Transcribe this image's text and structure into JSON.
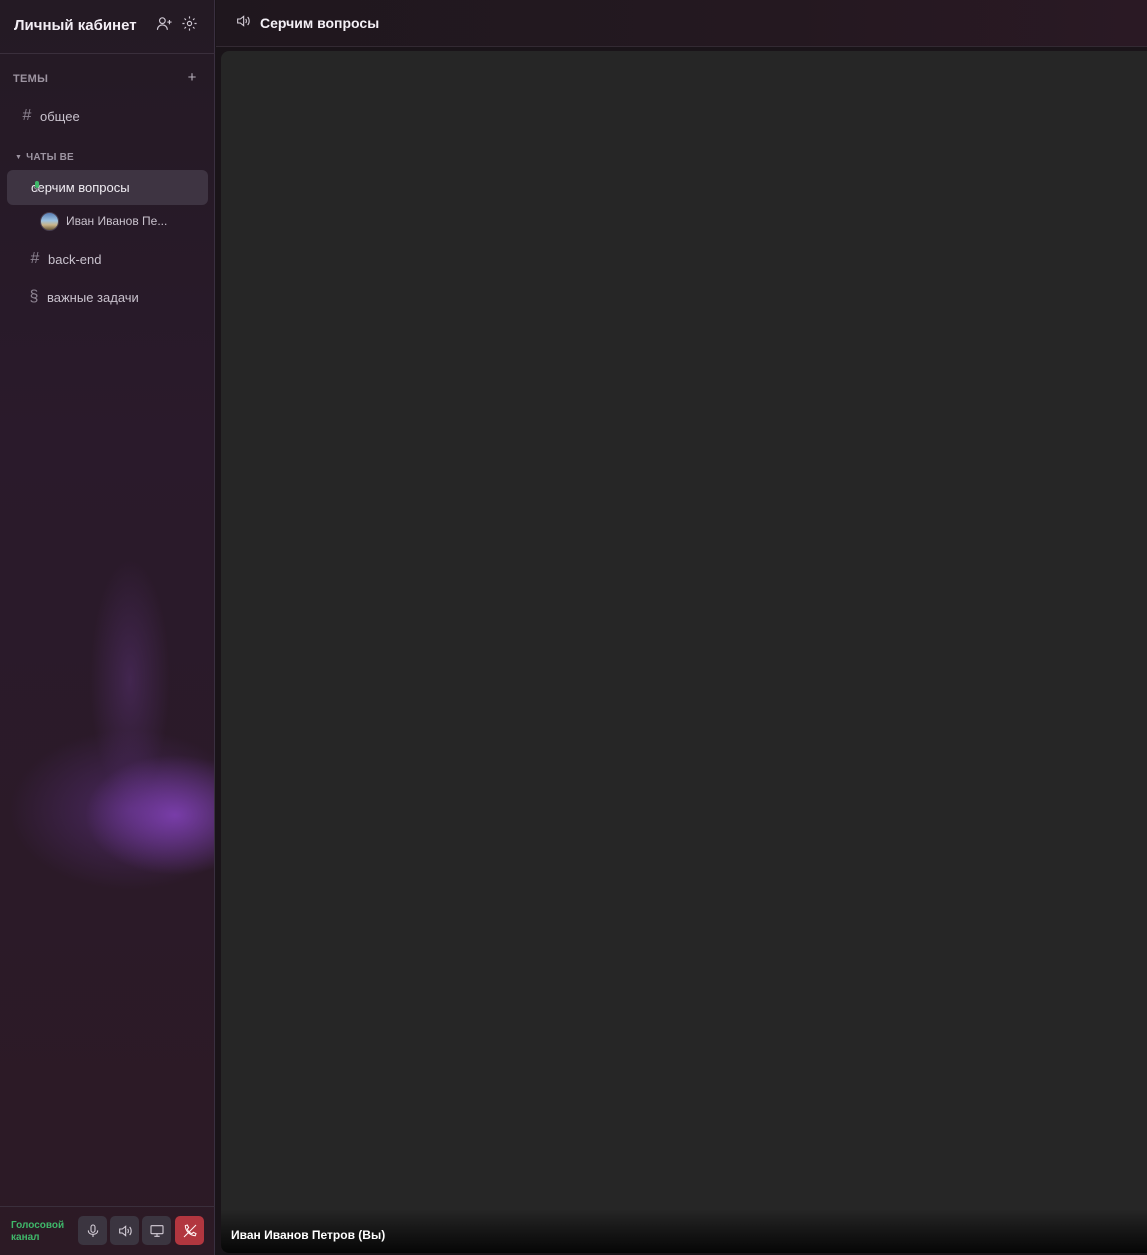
{
  "sidebar": {
    "title": "Личный кабинет",
    "section_label": "ТЕМЫ",
    "section_add": "+",
    "channels_top": [
      {
        "glyph": "#",
        "label": "общее"
      }
    ],
    "category": {
      "label": "ЧАТЫ ВЕ",
      "caret": "▼",
      "active_channel": {
        "label": "серчим вопросы",
        "icon": "mic-icon"
      },
      "members": [
        {
          "name": "Иван Иванов Пе..."
        }
      ]
    },
    "channels_bottom": [
      {
        "glyph": "#",
        "label": "back-end"
      },
      {
        "glyph": "§",
        "label": "важные задачи"
      }
    ]
  },
  "voice_panel": {
    "status": "Голосовой канал",
    "status_color": "#3fb86a",
    "danger_color": "#b2363f"
  },
  "main": {
    "header_icon": "speaker-icon",
    "title": "Серчим вопросы",
    "participant_name": "Иван Иванов Петров (Вы)"
  }
}
